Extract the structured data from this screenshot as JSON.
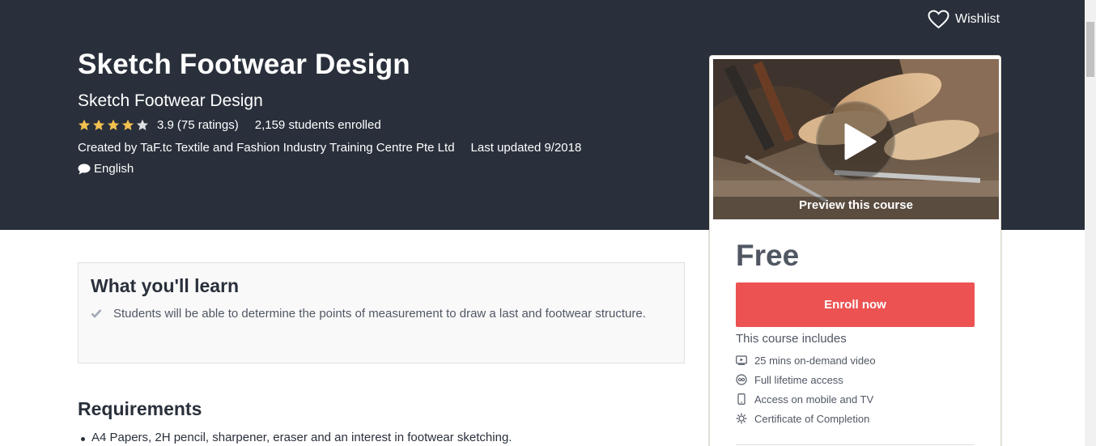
{
  "header": {
    "wishlist_label": "Wishlist"
  },
  "course": {
    "title": "Sketch Footwear Design",
    "subtitle": "Sketch Footwear Design",
    "rating_value": "3.9",
    "rating_count": "(75 ratings)",
    "rating_stars": 3.9,
    "students_enrolled": "2,159 students enrolled",
    "created_by": "Created by TaF.tc Textile and Fashion Industry Training Centre Pte Ltd",
    "last_updated": "Last updated 9/2018",
    "language": "English"
  },
  "sidebar": {
    "preview_label": "Preview this course",
    "price": "Free",
    "enroll_label": "Enroll now",
    "includes_title": "This course includes",
    "includes": [
      {
        "icon": "video-icon",
        "label": "25 mins on-demand video"
      },
      {
        "icon": "infinity-icon",
        "label": "Full lifetime access"
      },
      {
        "icon": "mobile-icon",
        "label": "Access on mobile and TV"
      },
      {
        "icon": "certificate-icon",
        "label": "Certificate of Completion"
      }
    ]
  },
  "learn": {
    "title": "What you'll learn",
    "items": [
      "Students will be able to determine the points of measurement to draw a last and footwear structure."
    ]
  },
  "requirements": {
    "title": "Requirements",
    "items": [
      "A4 Papers, 2H pencil, sharpener, eraser and an interest in footwear sketching."
    ]
  },
  "colors": {
    "hero_bg": "#29303b",
    "accent": "#ec5252",
    "star": "#f4c150",
    "text_muted": "#505763"
  }
}
